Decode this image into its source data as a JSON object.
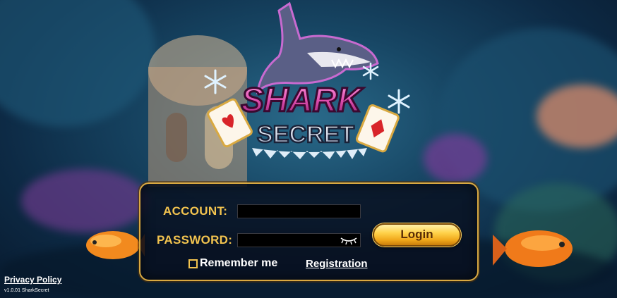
{
  "game": {
    "title_line1": "SHARK",
    "title_line2": "SECRET"
  },
  "login_form": {
    "account_label": "ACCOUNT:",
    "account_value": "",
    "password_label": "PASSWORD:",
    "password_value": "",
    "login_button": "Login",
    "remember_label": "Remember me",
    "remember_checked": false,
    "registration_link": "Registration"
  },
  "footer": {
    "privacy_policy": "Privacy Policy",
    "version": "v1.0.01 SharkSecret"
  },
  "colors": {
    "label_gold": "#f3c44f",
    "panel_border": "#d9a941",
    "button_gold": "#ffd24a",
    "title_pink": "#e04fb0"
  },
  "icons": {
    "password_toggle": "eye-closed-icon",
    "logo_cards": "playing-card-icon",
    "logo_snowflakes": "snowflake-icon"
  }
}
